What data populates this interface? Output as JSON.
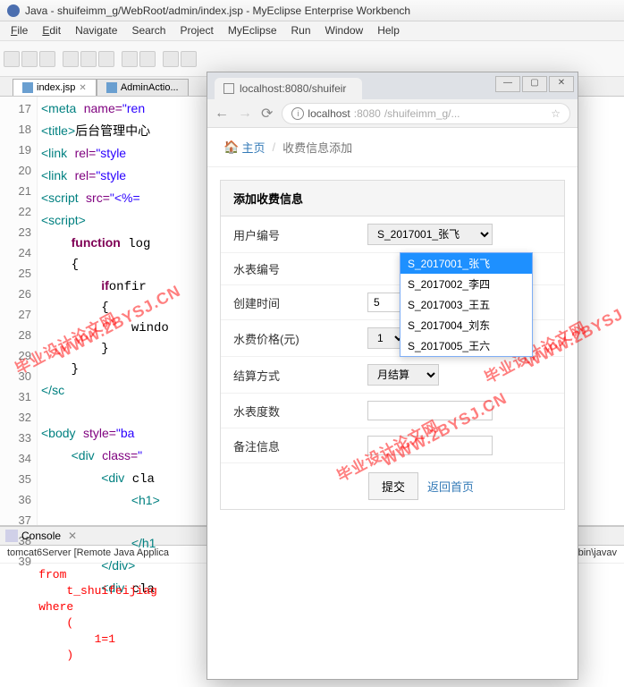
{
  "window": {
    "title": "Java - shuifeimm_g/WebRoot/admin/index.jsp - MyEclipse Enterprise Workbench"
  },
  "menu": {
    "file": "File",
    "edit": "Edit",
    "navigate": "Navigate",
    "search": "Search",
    "project": "Project",
    "myeclipse": "MyEclipse",
    "run": "Run",
    "window": "Window",
    "help": "Help"
  },
  "editor_tabs": {
    "t1": "index.jsp",
    "t2": "AdminActio..."
  },
  "gutter": [
    "17",
    "18",
    "19",
    "20",
    "21",
    "22",
    "23",
    "24",
    "25",
    "26",
    "27",
    "28",
    "29",
    "30",
    "31",
    "32",
    "33",
    "34",
    "35",
    "36",
    "37",
    "38",
    "39"
  ],
  "code": {
    "l17a": "<meta ",
    "l17b": "name=",
    "l17c": "\"ren",
    "l17d": "",
    "l18a": "<title>",
    "l18b": "后台管理中心",
    "l18c": "",
    "l19a": "<link ",
    "l19b": "rel=",
    "l19c": "\"style",
    "l19d": "",
    "l20a": "<link ",
    "l20b": "rel=",
    "l20c": "\"style",
    "l20d": "",
    "l21a": "<script ",
    "l21b": "src=",
    "l21c": "\"<%=",
    "l21d": "",
    "l22": "<script>",
    "l23a": "    function ",
    "l23b": "log",
    "l24": "    {",
    "l25a": "        if",
    "l25b": "(confir",
    "l26": "        {",
    "l27": "            windo",
    "l28": "        }",
    "l29": "    }",
    "l30": "</sc",
    "l31": "",
    "l32a": "<body ",
    "l32b": "style=",
    "l32c": "\"ba",
    "l33a": "    <div ",
    "l33b": "class=",
    "l33c": "\"",
    "l34": "        <div cla",
    "l35": "            <h1>",
    "l36": "",
    "l37": "            </h1",
    "l38": "        </div>",
    "l39": "        <div cla"
  },
  "console": {
    "tab": "Console",
    "sub_left": "tomcat6Server [Remote Java Applica",
    "sub_right": "\\bin\\javav",
    "body": "    from\n        t_shuifeijiag\n    where\n        (\n            1=1\n        )"
  },
  "browser": {
    "tab_title": "localhost:8080/shuifeir",
    "url_host": "localhost",
    "url_port": ":8080",
    "url_path": "/shuifeimm_g/...",
    "bc_home": "主页",
    "bc_cur": "收费信息添加",
    "panel_title": "添加收费信息",
    "labels": {
      "user": "用户编号",
      "meter": "水表编号",
      "created": "创建时间",
      "price": "水费价格(元)",
      "method": "结算方式",
      "reading": "水表度数",
      "remark": "备注信息"
    },
    "selects": {
      "user_sel": "S_2017001_张飞",
      "price_sel": "1",
      "method_sel": "月结算"
    },
    "inputs": {
      "created_val": "5"
    },
    "dropdown": [
      "S_2017001_张飞",
      "S_2017002_李四",
      "S_2017003_王五",
      "S_2017004_刘东",
      "S_2017005_王六"
    ],
    "actions": {
      "submit": "提交",
      "back": "返回首页"
    }
  },
  "watermark": {
    "cn": "毕业设计论文网",
    "en": "WWW.2BYSJ.CN"
  }
}
